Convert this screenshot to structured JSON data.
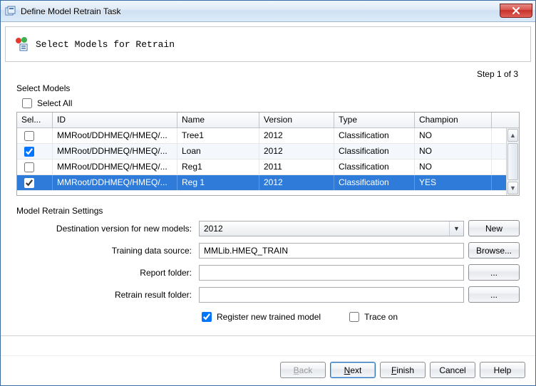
{
  "window": {
    "title": "Define Model Retrain Task"
  },
  "header": {
    "text": "Select Models for Retrain"
  },
  "step": {
    "label": "Step 1 of 3"
  },
  "select_models": {
    "group_label": "Select Models",
    "select_all_label": "Select All",
    "columns": {
      "sel": "Sel...",
      "id": "ID",
      "name": "Name",
      "version": "Version",
      "type": "Type",
      "champion": "Champion"
    },
    "rows": [
      {
        "checked": false,
        "id": "MMRoot/DDHMEQ/HMEQ/...",
        "name": "Tree1",
        "version": "2012",
        "type": "Classification",
        "champion": "NO"
      },
      {
        "checked": true,
        "id": "MMRoot/DDHMEQ/HMEQ/...",
        "name": "Loan",
        "version": "2012",
        "type": "Classification",
        "champion": "NO"
      },
      {
        "checked": false,
        "id": "MMRoot/DDHMEQ/HMEQ/...",
        "name": "Reg1",
        "version": "2011",
        "type": "Classification",
        "champion": "NO"
      },
      {
        "checked": true,
        "id": "MMRoot/DDHMEQ/HMEQ/...",
        "name": "Reg 1",
        "version": "2012",
        "type": "Classification",
        "champion": "YES"
      }
    ]
  },
  "settings": {
    "group_label": "Model Retrain Settings",
    "dest_version_label": "Destination version for new models:",
    "dest_version_value": "2012",
    "new_button": "New",
    "training_source_label": "Training data source:",
    "training_source_value": "MMLib.HMEQ_TRAIN",
    "browse_button": "Browse...",
    "report_folder_label": "Report folder:",
    "report_folder_value": "",
    "retrain_result_label": "Retrain result folder:",
    "retrain_result_value": "",
    "ellipsis": "...",
    "register_label": "Register new trained model",
    "trace_label": "Trace on"
  },
  "footer": {
    "back": "Back",
    "next": "Next",
    "finish": "Finish",
    "cancel": "Cancel",
    "help": "Help"
  }
}
